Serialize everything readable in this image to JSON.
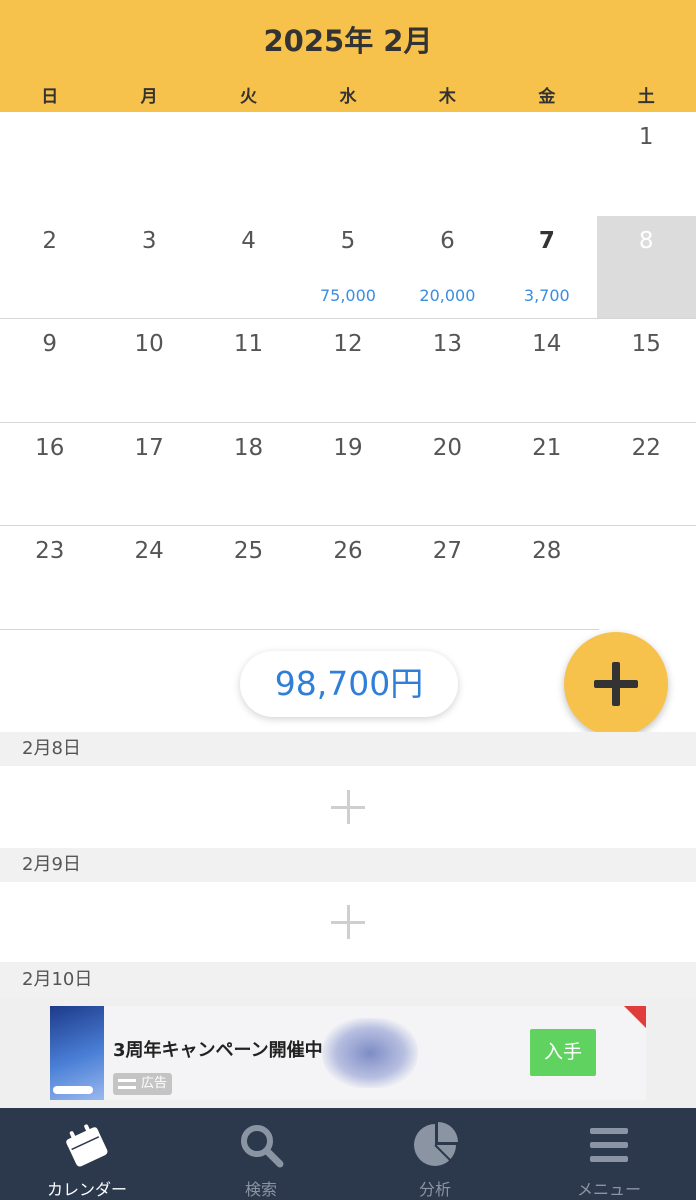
{
  "header": {
    "title": "2025年 2月",
    "weekdays": [
      "日",
      "月",
      "火",
      "水",
      "木",
      "金",
      "土"
    ]
  },
  "calendar": {
    "weeks": [
      [
        "",
        "",
        "",
        "",
        "",
        "",
        "1"
      ],
      [
        "2",
        "3",
        "4",
        "5",
        "6",
        "7",
        "8"
      ],
      [
        "9",
        "10",
        "11",
        "12",
        "13",
        "14",
        "15"
      ],
      [
        "16",
        "17",
        "18",
        "19",
        "20",
        "21",
        "22"
      ],
      [
        "23",
        "24",
        "25",
        "26",
        "27",
        "28",
        ""
      ]
    ],
    "amounts": {
      "5": "75,000",
      "6": "20,000",
      "7": "3,700"
    },
    "today": "7",
    "selected": "8"
  },
  "summary": {
    "total": "98,700円"
  },
  "day_list": [
    {
      "date": "2月8日"
    },
    {
      "date": "2月9日"
    },
    {
      "date": "2月10日"
    }
  ],
  "ad": {
    "headline": "3周年キャンペーン開催中",
    "badge": "広告",
    "button": "入手"
  },
  "tabbar": [
    {
      "label": "カレンダー",
      "icon": "calendar-icon",
      "active": true
    },
    {
      "label": "検索",
      "icon": "search-icon",
      "active": false
    },
    {
      "label": "分析",
      "icon": "pie-chart-icon",
      "active": false
    },
    {
      "label": "メニュー",
      "icon": "menu-icon",
      "active": false
    }
  ],
  "colors": {
    "header": "#f6c24b",
    "amount": "#3b8de0",
    "tabbar": "#2c394d"
  }
}
